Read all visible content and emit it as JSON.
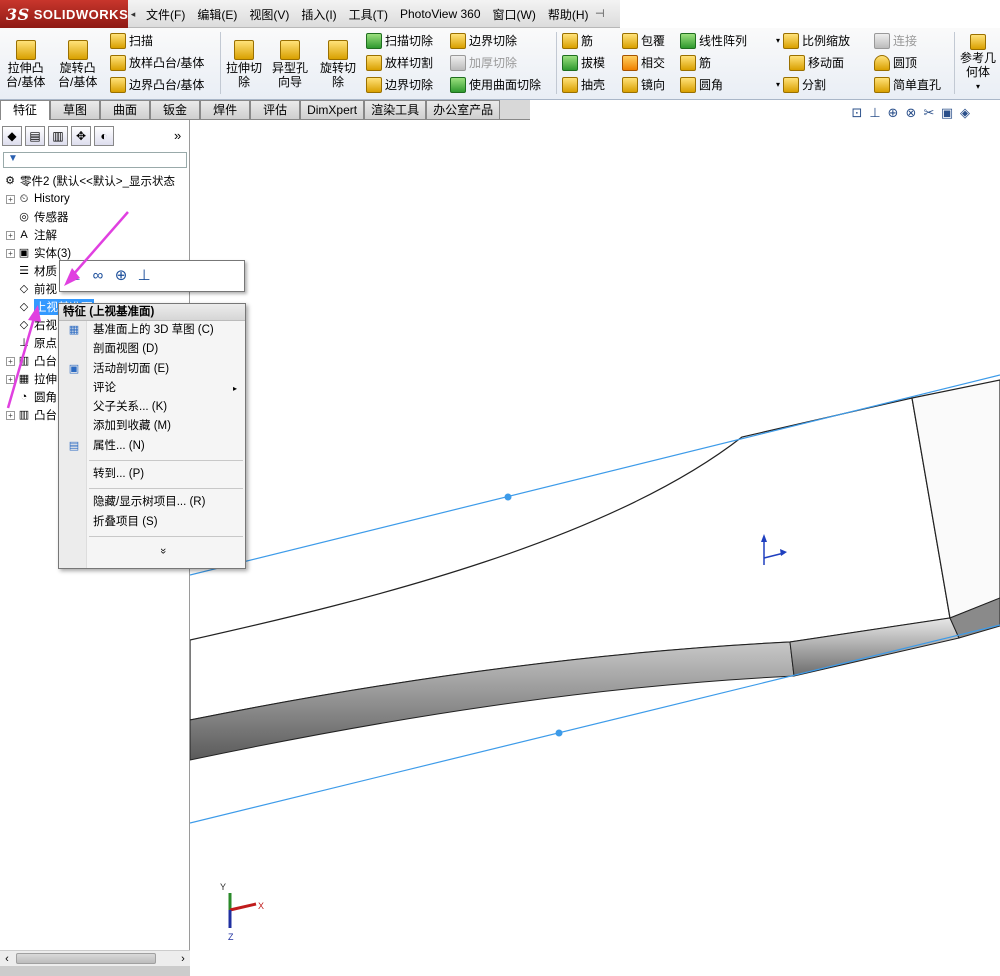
{
  "app": {
    "brand_prefix": "3S",
    "brand": "SOLIDWORKS",
    "menu_toggle": "◂"
  },
  "menus": [
    "文件(F)",
    "编辑(E)",
    "视图(V)",
    "插入(I)",
    "工具(T)",
    "PhotoView 360",
    "窗口(W)",
    "帮助(H)"
  ],
  "ribbon": {
    "extrude_boss": "拉伸凸\n台/基体",
    "revolve_boss": "旋转凸\n台/基体",
    "sweep": "扫描",
    "loft_boss": "放样凸台/基体",
    "boundary_boss": "边界凸台/基体",
    "extrude_cut": "拉伸切\n除",
    "hole_wizard": "异型孔\n向导",
    "revolve_cut": "旋转切\n除",
    "sweep_cut": "扫描切除",
    "loft_cut": "放样切割",
    "boundary_cut": "边界切除",
    "boundary_cut2": "边界切除",
    "thicken_cut": "加厚切除",
    "surface_cut": "使用曲面切除",
    "rib": "筋",
    "draft": "拔模",
    "shell": "抽壳",
    "wrap": "包覆",
    "intersect": "相交",
    "mirror": "镜向",
    "linear_pattern": "线性阵列",
    "rib2": "筋",
    "fillet": "圆角",
    "scale": "比例缩放",
    "move_face": "移动面",
    "split": "分割",
    "connect": "连接",
    "dome": "圆顶",
    "simple_hole": "简单直孔",
    "ref_geometry": "参考几\n何体"
  },
  "tabs": [
    "特征",
    "草图",
    "曲面",
    "钣金",
    "焊件",
    "评估",
    "DimXpert",
    "渲染工具",
    "办公室产品"
  ],
  "tree": {
    "filter": "▼",
    "root": "零件2 (默认<<默认>_显示状态",
    "items": [
      {
        "label": "History",
        "icon": "history-icon"
      },
      {
        "label": "传感器",
        "icon": "sensor-icon"
      },
      {
        "label": "注解",
        "icon": "annotation-icon"
      },
      {
        "label": "实体(3)",
        "icon": "solid-bodies-icon"
      },
      {
        "label": "材质",
        "icon": "material-icon"
      },
      {
        "label": "前视",
        "icon": "plane-icon"
      },
      {
        "label": "上视基准面",
        "icon": "plane-icon"
      },
      {
        "label": "右视",
        "icon": "plane-icon"
      },
      {
        "label": "原点",
        "icon": "origin-icon"
      },
      {
        "label": "凸台",
        "icon": "boss-icon"
      },
      {
        "label": "拉伸",
        "icon": "extrude-icon"
      },
      {
        "label": "圆角",
        "icon": "fillet-icon"
      },
      {
        "label": "凸台",
        "icon": "boss-icon"
      }
    ]
  },
  "context_menu": {
    "header": "特征 (上视基准面)",
    "items": [
      {
        "label": "基准面上的 3D 草图 (C)"
      },
      {
        "label": "剖面视图 (D)"
      },
      {
        "label": "活动剖切面 (E)"
      },
      {
        "label": "评论"
      },
      {
        "label": "父子关系... (K)"
      },
      {
        "label": "添加到收藏 (M)"
      },
      {
        "label": "属性... (N)"
      },
      {
        "label": "转到... (P)"
      },
      {
        "label": "隐藏/显示树项目... (R)"
      },
      {
        "label": "折叠项目 (S)"
      }
    ],
    "more": "»"
  },
  "triad": {
    "x": "X",
    "y": "Y",
    "z": "Z"
  },
  "colors": {
    "accent_pink": "#e040e0",
    "plane_line": "#3d9be9",
    "selection": "#3399ff"
  }
}
